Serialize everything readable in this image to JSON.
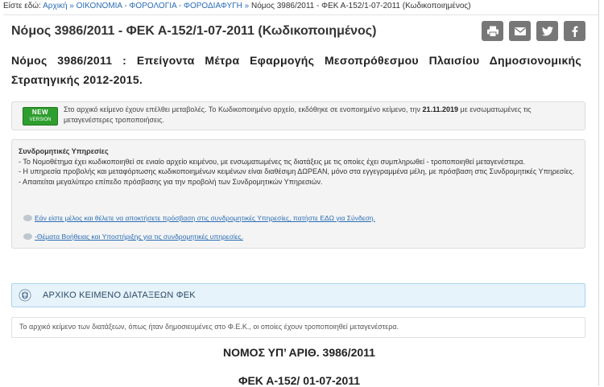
{
  "breadcrumb": {
    "prefix": "Είστε εδώ:",
    "home": "Αρχική",
    "category": "ΟΙΚΟΝΟΜΙΑ - ΦΟΡΟΛΟΓΙΑ - ΦΟΡΟΔΙΑΦΥΓΗ",
    "current": "Νόμος 3986/2011 - ΦΕΚ Α-152/1-07-2011 (Κωδικοποιημένος)",
    "separator": "»"
  },
  "page": {
    "title": "Νόμος 3986/2011 - ΦΕΚ Α-152/1-07-2011 (Κωδικοποιημένος)",
    "subtitle": "Νόμος 3986/2011 : Επείγοντα Μέτρα Εφαρμογής Μεσοπρόθεσμου Πλαισίου Δημοσιονομικής Στρατηγικής 2012-2015."
  },
  "share": {
    "icons": [
      "print-icon",
      "email-icon",
      "twitter-icon",
      "facebook-icon"
    ],
    "color": "#777777"
  },
  "notice": {
    "badge_top": "NEW",
    "badge_bottom": "VERSION",
    "text_before": "Στο αρχικό κείμενο έχουν επέλθει μεταβολές. Το Κωδικοποιημένο αρχείο, εκδόθηκε σε ενοποιημένο κείμενο, την ",
    "date": "21.11.2019",
    "text_after": " με ενσωματωμένες τις μεταγενέστερες τροποποιήσεις."
  },
  "subscription": {
    "title": "Συνδρομητικές Υπηρεσίες",
    "lines": [
      "- Το Νομοθέτημα έχει κωδικοποιηθεί σε ενιαίο αρχείο κειμένου, με ενσωματωμένες τις διατάξεις με τις οποίες έχει συμπληρωθεί - τροποποιηθεί μεταγενέστερα.",
      "- Η υπηρεσία προβολής και μεταφόρτωσης κωδικοποιημένων κειμένων είναι διαθέσιμη ΔΩΡΕΑΝ, μόνο στα εγγεγραμμένα μέλη, με πρόσβαση στις Συνδρομητικές Υπηρεσίες.",
      "- Απαιτείται μεγαλύτερο επίπεδο πρόσβασης για την προβολή των Συνδρομητικών Υπηρεσιών."
    ],
    "login_link": "Εάν είστε μέλος και θέλετε να αποκτήσετε πρόσβαση στις συνδρομητικές Υπηρεσίες, πατήστε ΕΔΩ για Σύνδεση.",
    "help_link": "-Θέματα Βοήθειας και Υποστήριξης για τις συνδρομητικές υπηρεσίες."
  },
  "original_panel": {
    "title": "ΑΡΧΙΚΟ ΚΕΙΜΕΝΟ ΔΙΑΤΑΞΕΩΝ ΦΕΚ",
    "note": "Το αρχικό κείμενο των διατάξεων, όπως ήταν δημοσιευμένες στο Φ.Ε.Κ., οι οποίες έχουν τροποποιηθεί μεταγενέστερα."
  },
  "document": {
    "heading": "ΝΟΜΟΣ ΥΠ’ ΑΡΙΘ. 3986/2011",
    "fek": "ΦΕΚ Α-152/ 01-07-2011"
  },
  "colors": {
    "link": "#2a6db5",
    "badge_green": "#2e9e2e",
    "panel_bg": "#e7f3fb",
    "panel_border": "#a9d3ee"
  }
}
